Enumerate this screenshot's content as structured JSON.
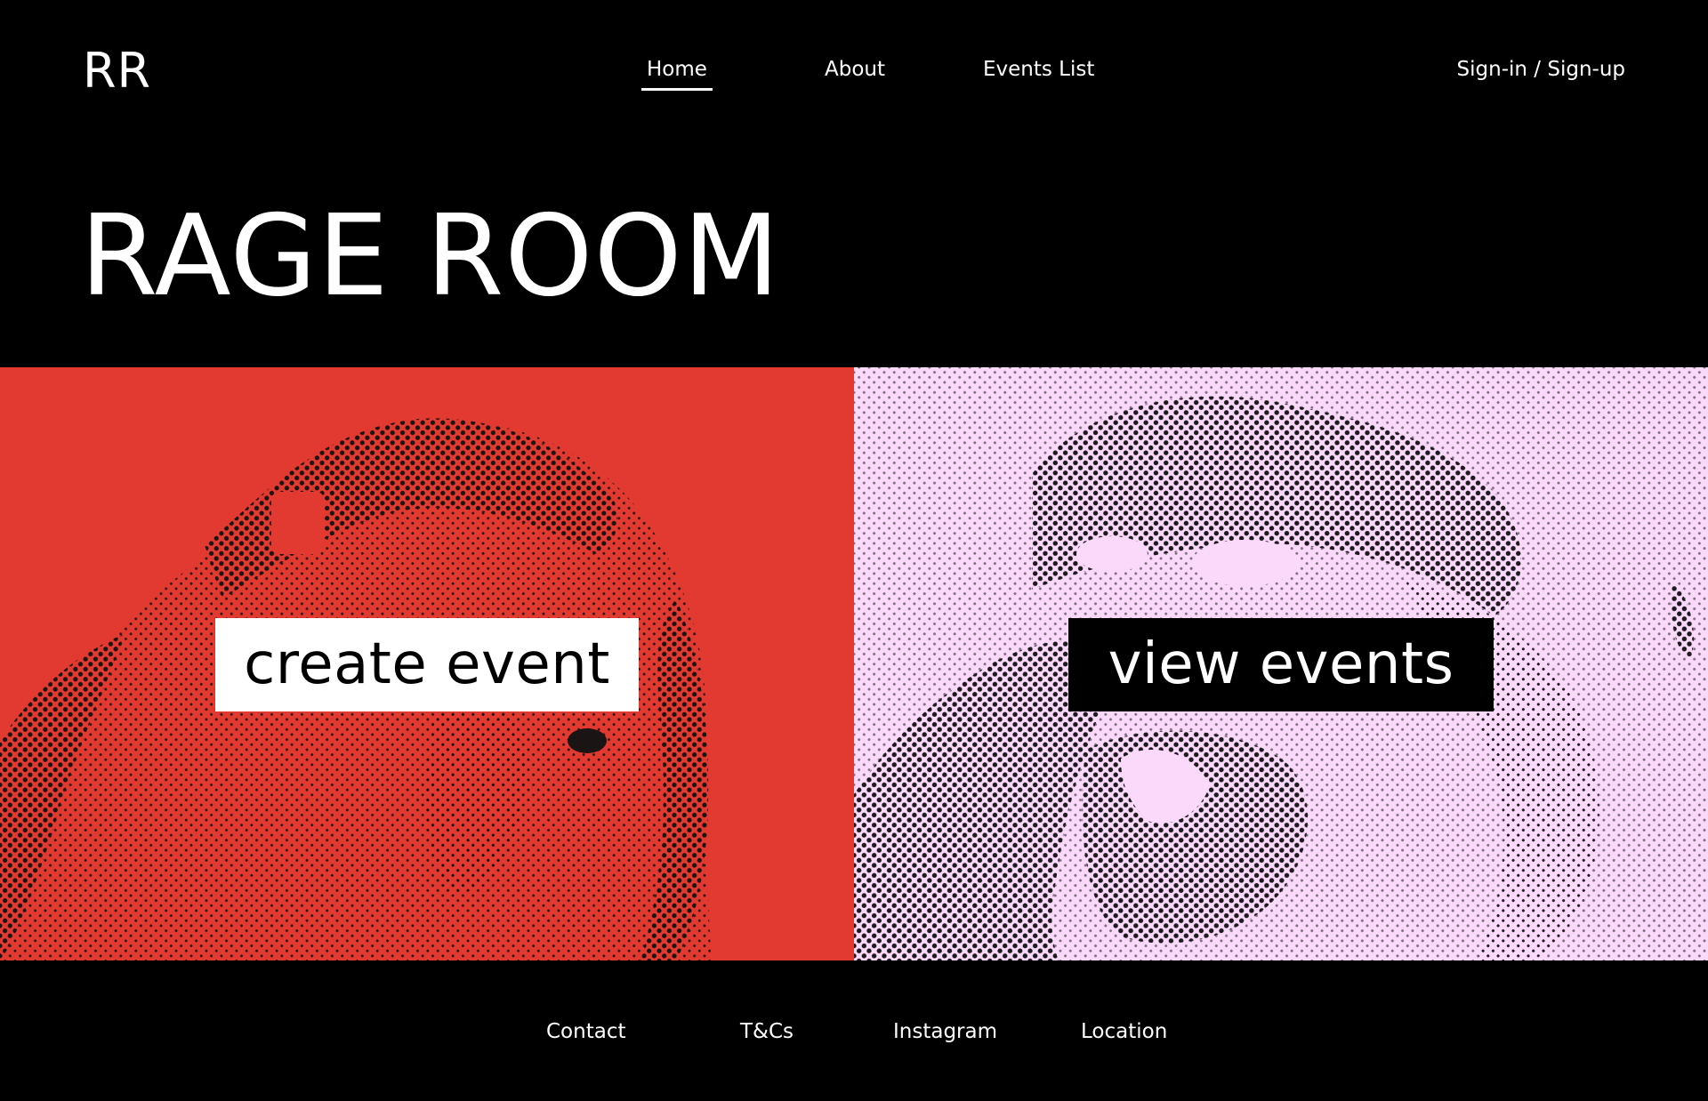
{
  "brand": {
    "logo": "RR",
    "title": "RAGE ROOM"
  },
  "nav": {
    "items": [
      {
        "label": "Home",
        "active": true
      },
      {
        "label": "About",
        "active": false
      },
      {
        "label": "Events List",
        "active": false
      }
    ],
    "auth_label": "Sign-in / Sign-up"
  },
  "panels": {
    "create": {
      "label": "create event",
      "bg_color": "#e23a30"
    },
    "view": {
      "label": "view events",
      "bg_color": "#fbd9fb"
    }
  },
  "footer": {
    "links": [
      "Contact",
      "T&Cs",
      "Instagram",
      "Location"
    ]
  },
  "colors": {
    "background": "#000000",
    "text": "#ffffff",
    "accent_red": "#e23a30",
    "accent_pink": "#fbd9fb"
  }
}
